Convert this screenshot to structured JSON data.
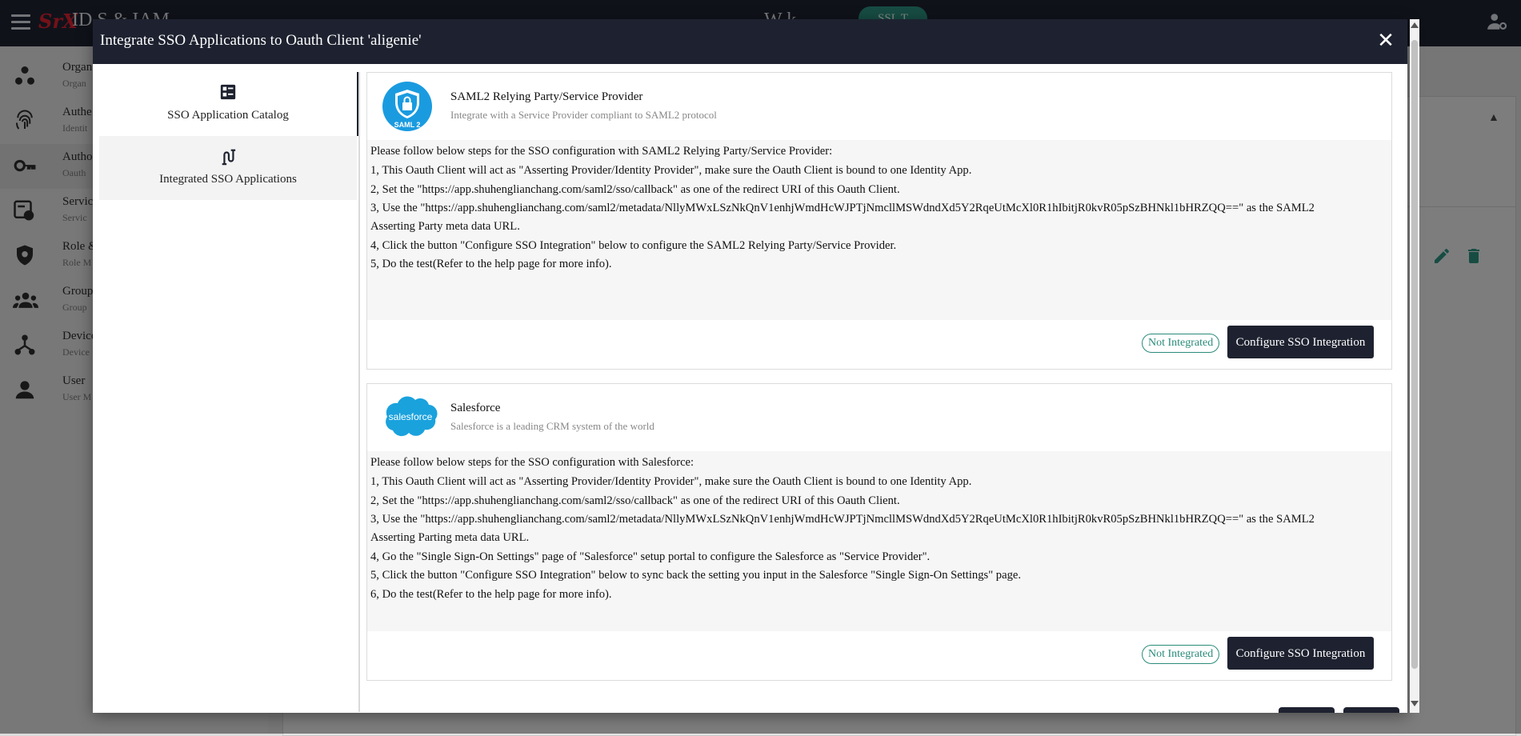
{
  "background": {
    "logo": "SrX",
    "app_title": "ID  S & IAM",
    "center_title": "W  k",
    "center_pill": "SSL T",
    "sidebar": [
      {
        "title": "Organ",
        "subtitle": "Organ",
        "icon": "organization-icon"
      },
      {
        "title": "Authe",
        "subtitle": "Identit",
        "icon": "fingerprint-icon"
      },
      {
        "title": "Autho",
        "subtitle": "Oauth",
        "icon": "key-icon"
      },
      {
        "title": "Servic",
        "subtitle": "Servic",
        "icon": "service-link-icon"
      },
      {
        "title": "Role &",
        "subtitle": "Role M",
        "icon": "shield-icon"
      },
      {
        "title": "Group",
        "subtitle": "Group",
        "icon": "group-icon"
      },
      {
        "title": "Device",
        "subtitle": "Device",
        "icon": "device-tree-icon"
      },
      {
        "title": "User",
        "subtitle": "User M",
        "icon": "person-icon"
      }
    ]
  },
  "modal": {
    "title": "Integrate SSO Applications to Oauth Client 'aligenie'",
    "close_label": "✕",
    "tabs": [
      {
        "label": "SSO Application Catalog",
        "icon": "catalog-icon"
      },
      {
        "label": "Integrated SSO Applications",
        "icon": "integration-icon"
      }
    ],
    "apps": [
      {
        "name": "SAML2 Relying Party/Service Provider",
        "description": "Integrate with a Service Provider compliant to SAML2 protocol",
        "logo_text": "SAML 2",
        "steps": [
          "Please follow below steps for the SSO configuration with SAML2 Relying Party/Service Provider:",
          "1, This Oauth Client will act as \"Asserting Provider/Identity Provider\", make sure the Oauth Client is bound to one Identity App.",
          "2, Set the \"https://app.shuhenglianchang.com/saml2/sso/callback\" as one of the redirect URI of this Oauth Client.",
          "3, Use the \"https://app.shuhenglianchang.com/saml2/metadata/NllyMWxLSzNkQnV1enhjWmdHcWJPTjNmcllMSWdndXd5Y2RqeUtMcXl0R1hIbitjR0kvR05pSzBHNkl1bHRZQQ==\" as the SAML2",
          "Asserting Party meta data URL.",
          "4, Click the button \"Configure SSO Integration\" below to configure the SAML2 Relying Party/Service Provider.",
          "5, Do the test(Refer to the help page for more info)."
        ],
        "status": "Not Integrated",
        "button": "Configure SSO Integration"
      },
      {
        "name": "Salesforce",
        "description": "Salesforce is a leading CRM system of the world",
        "logo_text": "salesforce",
        "steps": [
          "Please follow below steps for the SSO configuration with Salesforce:",
          "1, This Oauth Client will act as \"Asserting Provider/Identity Provider\", make sure the Oauth Client is bound to one Identity App.",
          "2, Set the \"https://app.shuhenglianchang.com/saml2/sso/callback\" as one of the redirect URI of this Oauth Client.",
          "3, Use the \"https://app.shuhenglianchang.com/saml2/metadata/NllyMWxLSzNkQnV1enhjWmdHcWJPTjNmcllMSWdndXd5Y2RqeUtMcXl0R1hIbitjR0kvR05pSzBHNkl1bHRZQQ==\" as the SAML2",
          "Asserting Parting meta data URL.",
          "4, Go the \"Single Sign-On Settings\" page of \"Salesforce\" setup portal to configure the Salesforce as \"Service Provider\".",
          "5, Click the button \"Configure SSO Integration\" below to sync back the setting you input in the Salesforce \"Single Sign-On Settings\" page.",
          "6, Do the test(Refer to the help page for more info)."
        ],
        "status": "Not Integrated",
        "button": "Configure SSO Integration"
      }
    ]
  },
  "colors": {
    "header_bg": "#1e2230",
    "accent_teal": "#2b8b7b",
    "saml_blue": "#1a9be0",
    "salesforce_blue": "#1aa2dd",
    "logo_red": "#d3202f"
  }
}
